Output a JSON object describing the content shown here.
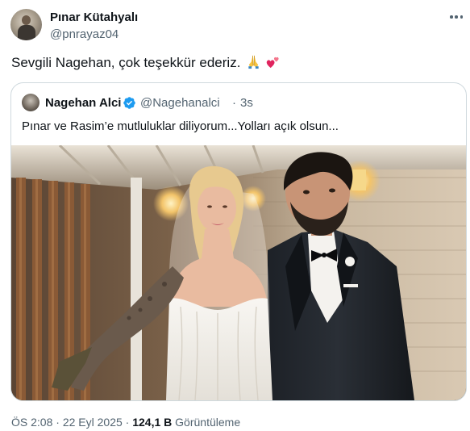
{
  "author": {
    "display_name": "Pınar Kütahyalı",
    "handle": "@pnrayaz04"
  },
  "tweet": {
    "text": "Sevgili Nagehan, çok teşekkür ederiz.",
    "emojis": [
      "folded-hands",
      "two-hearts"
    ]
  },
  "quoted": {
    "display_name": "Nagehan Alci",
    "handle": "@Nagehanalci",
    "separator": "·",
    "time": "3s",
    "verified": true,
    "text": "Pınar ve Rasim’e mutluluklar diliyorum...Yolları açık olsun..."
  },
  "meta": {
    "time": "ÖS 2:08",
    "separator": "·",
    "date": "22 Eyl 2025",
    "views_count": "124,1 B",
    "views_label": "Görüntüleme"
  },
  "colors": {
    "text_primary": "#0f1419",
    "text_secondary": "#536471",
    "border": "#cfd9de",
    "verified_blue": "#1d9bf0"
  }
}
